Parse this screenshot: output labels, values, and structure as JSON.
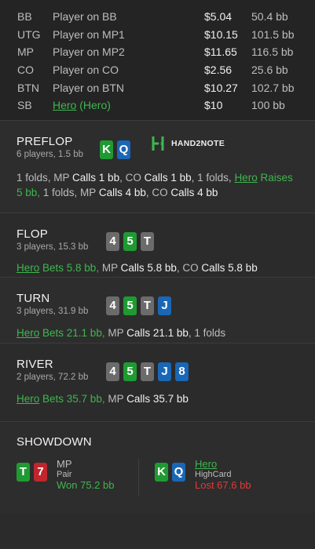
{
  "players": [
    {
      "pos": "BB",
      "name": "Player on BB",
      "stack": "$5.04",
      "bb": "50.4 bb"
    },
    {
      "pos": "UTG",
      "name": "Player on MP1",
      "stack": "$10.15",
      "bb": "101.5 bb"
    },
    {
      "pos": "MP",
      "name": "Player on MP2",
      "stack": "$11.65",
      "bb": "116.5 bb"
    },
    {
      "pos": "CO",
      "name": "Player on CO",
      "stack": "$2.56",
      "bb": "25.6 bb"
    },
    {
      "pos": "BTN",
      "name": "Player on BTN",
      "stack": "$10.27",
      "bb": "102.7 bb"
    },
    {
      "pos": "SB",
      "name": "Hero",
      "name_suffix": "(Hero)",
      "stack": "$10",
      "bb": "100 bb"
    }
  ],
  "preflop": {
    "title": "PREFLOP",
    "sub": "6 players, 1.5 bb",
    "cards": [
      {
        "v": "K",
        "c": "green"
      },
      {
        "v": "Q",
        "c": "blue"
      }
    ],
    "logo": "HAND2NOTE",
    "a1": "1 folds, MP ",
    "a2": "Calls 1 bb",
    ", ": ", ",
    "a3": ", CO ",
    "a4": "Calls 1 bb",
    "a5": ", 1 folds, ",
    "a6": "Hero",
    "a7": " Raises",
    "a8": "5 bb,",
    "a9": " 1 folds, MP ",
    "a10": "Calls 4 bb",
    "a11": ", CO ",
    "a12": "Calls 4 bb"
  },
  "flop": {
    "title": "FLOP",
    "sub": "3 players, 15.3 bb",
    "cards": [
      {
        "v": "4",
        "c": "grey"
      },
      {
        "v": "5",
        "c": "green"
      },
      {
        "v": "T",
        "c": "grey"
      }
    ],
    "a1": "Hero",
    "a2": " Bets 5.8 bb,",
    "a3": " MP ",
    "a4": "Calls 5.8 bb",
    "a5": ", CO ",
    "a6": "Calls 5.8 bb"
  },
  "turn": {
    "title": "TURN",
    "sub": "3 players, 31.9 bb",
    "cards": [
      {
        "v": "4",
        "c": "grey"
      },
      {
        "v": "5",
        "c": "green"
      },
      {
        "v": "T",
        "c": "grey"
      },
      {
        "v": "J",
        "c": "blue"
      }
    ],
    "a1": "Hero",
    "a2": " Bets 21.1 bb,",
    "a3": " MP ",
    "a4": "Calls 21.1 bb",
    "a5": ", 1 folds"
  },
  "river": {
    "title": "RIVER",
    "sub": "2 players, 72.2 bb",
    "cards": [
      {
        "v": "4",
        "c": "grey"
      },
      {
        "v": "5",
        "c": "green"
      },
      {
        "v": "T",
        "c": "grey"
      },
      {
        "v": "J",
        "c": "blue"
      },
      {
        "v": "8",
        "c": "blue"
      }
    ],
    "a1": "Hero",
    "a2": " Bets 35.7 bb,",
    "a3": " MP ",
    "a4": "Calls 35.7 bb"
  },
  "showdown": {
    "title": "SHOWDOWN",
    "left": {
      "cards": [
        {
          "v": "T",
          "c": "green"
        },
        {
          "v": "7",
          "c": "red"
        }
      ],
      "name": "MP",
      "hand": "Pair",
      "result": "Won 75.2 bb"
    },
    "right": {
      "cards": [
        {
          "v": "K",
          "c": "green"
        },
        {
          "v": "Q",
          "c": "blue"
        }
      ],
      "name": "Hero",
      "hand": "HighCard",
      "result": "Lost 67.6 bb"
    }
  },
  "colors": {
    "green": "#3fb64e",
    "red": "#e03a3a",
    "card_green": "#1f9a32",
    "card_blue": "#1a67b5",
    "card_grey": "#6b6b6b",
    "card_red": "#c0262c"
  }
}
